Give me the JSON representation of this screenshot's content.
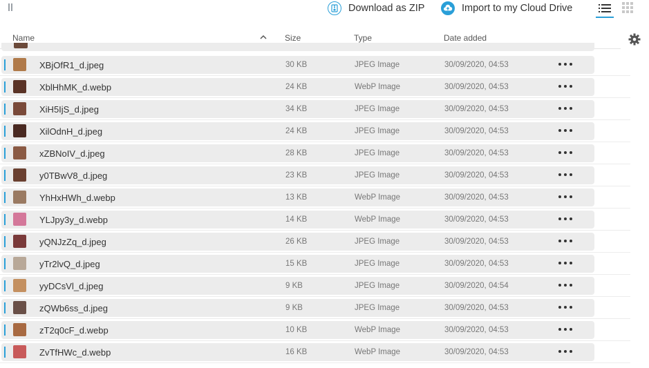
{
  "toolbar": {
    "download_zip_label": "Download as ZIP",
    "import_cloud_label": "Import to my Cloud Drive"
  },
  "columns": {
    "name": "Name",
    "size": "Size",
    "type": "Type",
    "date": "Date added"
  },
  "accent_color": "#2a9fd8",
  "files": [
    {
      "name": "XBjOfR1_d.jpeg",
      "size": "30 KB",
      "type": "JPEG Image",
      "date": "30/09/2020, 04:53",
      "thumb": "#b07a4a"
    },
    {
      "name": "XblHhMK_d.webp",
      "size": "24 KB",
      "type": "WebP Image",
      "date": "30/09/2020, 04:53",
      "thumb": "#5a3326"
    },
    {
      "name": "XiH5IjS_d.jpeg",
      "size": "34 KB",
      "type": "JPEG Image",
      "date": "30/09/2020, 04:53",
      "thumb": "#7a4a3a"
    },
    {
      "name": "XilOdnH_d.jpeg",
      "size": "24 KB",
      "type": "JPEG Image",
      "date": "30/09/2020, 04:53",
      "thumb": "#4a2a22"
    },
    {
      "name": "xZBNoIV_d.jpeg",
      "size": "28 KB",
      "type": "JPEG Image",
      "date": "30/09/2020, 04:53",
      "thumb": "#8a5a44"
    },
    {
      "name": "y0TBwV8_d.jpeg",
      "size": "23 KB",
      "type": "JPEG Image",
      "date": "30/09/2020, 04:53",
      "thumb": "#6a4030"
    },
    {
      "name": "YhHxHWh_d.webp",
      "size": "13 KB",
      "type": "WebP Image",
      "date": "30/09/2020, 04:53",
      "thumb": "#9a7a62"
    },
    {
      "name": "YLJpy3y_d.webp",
      "size": "14 KB",
      "type": "WebP Image",
      "date": "30/09/2020, 04:53",
      "thumb": "#d4789a"
    },
    {
      "name": "yQNJzZq_d.jpeg",
      "size": "26 KB",
      "type": "JPEG Image",
      "date": "30/09/2020, 04:53",
      "thumb": "#7a3a3a"
    },
    {
      "name": "yTr2lvQ_d.jpeg",
      "size": "15 KB",
      "type": "JPEG Image",
      "date": "30/09/2020, 04:53",
      "thumb": "#b8a898"
    },
    {
      "name": "yyDCsVl_d.jpeg",
      "size": "9 KB",
      "type": "JPEG Image",
      "date": "30/09/2020, 04:54",
      "thumb": "#c49060"
    },
    {
      "name": "zQWb6ss_d.jpeg",
      "size": "9 KB",
      "type": "JPEG Image",
      "date": "30/09/2020, 04:53",
      "thumb": "#6a5048"
    },
    {
      "name": "zT2q0cF_d.webp",
      "size": "10 KB",
      "type": "WebP Image",
      "date": "30/09/2020, 04:53",
      "thumb": "#a86a42"
    },
    {
      "name": "ZvTfHWc_d.webp",
      "size": "16 KB",
      "type": "WebP Image",
      "date": "30/09/2020, 04:53",
      "thumb": "#c85a5a"
    }
  ]
}
